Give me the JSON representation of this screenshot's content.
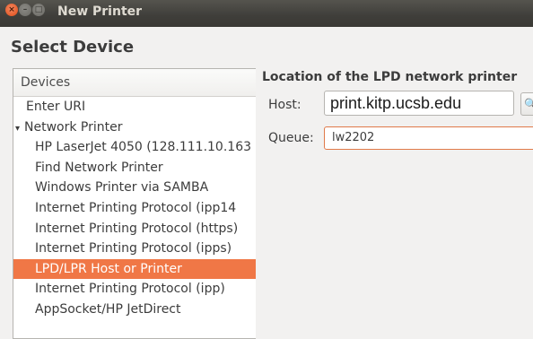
{
  "window": {
    "title": "New Printer",
    "close_glyph": "×",
    "min_glyph": "–",
    "max_glyph": "□"
  },
  "page": {
    "section_title": "Select Device"
  },
  "devices": {
    "header": "Devices",
    "items": [
      {
        "label": "Enter URI"
      },
      {
        "label": "Network Printer"
      },
      {
        "label": "HP LaserJet 4050 (128.111.10.163"
      },
      {
        "label": "Find Network Printer"
      },
      {
        "label": "Windows Printer via SAMBA"
      },
      {
        "label": "Internet Printing Protocol (ipp14"
      },
      {
        "label": "Internet Printing Protocol (https)"
      },
      {
        "label": "Internet Printing Protocol (ipps)"
      },
      {
        "label": "LPD/LPR Host or Printer"
      },
      {
        "label": "Internet Printing Protocol (ipp)"
      },
      {
        "label": "AppSocket/HP JetDirect"
      }
    ],
    "expanded_arrow": "▾"
  },
  "lpd": {
    "title": "Location of the LPD network printer",
    "host_label": "Host:",
    "host_value": "print.kitp.ucsb.edu",
    "queue_label": "Queue:",
    "queue_value": "lw2202",
    "browse_glyph": "🔍"
  },
  "colors": {
    "selection": "#f07746",
    "titlebar": "#3f3e3a",
    "window_bg": "#f2f1f0"
  }
}
